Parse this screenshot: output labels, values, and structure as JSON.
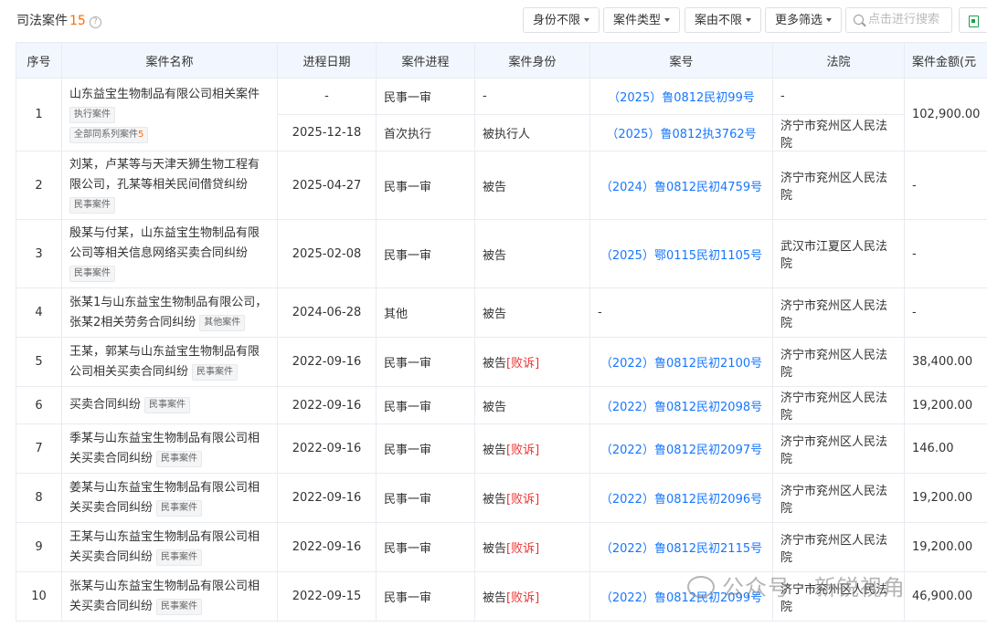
{
  "header": {
    "title": "司法案件",
    "count": "15",
    "help_icon": "?",
    "filters": [
      "身份不限",
      "案件类型",
      "案由不限",
      "更多筛选"
    ],
    "search_placeholder": "点击进行搜索"
  },
  "table": {
    "columns": [
      "序号",
      "案件名称",
      "进程日期",
      "案件进程",
      "案件身份",
      "案号",
      "法院",
      "案件金额(元"
    ],
    "rows": [
      {
        "no": "1",
        "name": "山东益宝生物制品有限公司相关案件",
        "tag": "执行案件",
        "tag2": "全部同系列案件",
        "tag2_count": "5",
        "sub": [
          {
            "date": "-",
            "stage": "民事一审",
            "role": "-",
            "case_no": "（2025）鲁0812民初99号",
            "court": "-"
          },
          {
            "date": "2025-12-18",
            "stage": "首次执行",
            "role": "被执行人",
            "case_no": "（2025）鲁0812执3762号",
            "court": "济宁市兖州区人民法院"
          }
        ],
        "amount": "102,900.00"
      },
      {
        "no": "2",
        "name": "刘某，卢某等与天津天狮生物工程有限公司，孔某等相关民间借贷纠纷",
        "tag": "民事案件",
        "date": "2025-04-27",
        "stage": "民事一审",
        "role": "被告",
        "lose": "",
        "case_no": "（2024）鲁0812民初4759号",
        "court": "济宁市兖州区人民法院",
        "amount": "-"
      },
      {
        "no": "3",
        "name": "殷某与付某，山东益宝生物制品有限公司等相关信息网络买卖合同纠纷",
        "tag": "民事案件",
        "date": "2025-02-08",
        "stage": "民事一审",
        "role": "被告",
        "lose": "",
        "case_no": "（2025）鄂0115民初1105号",
        "court": "武汉市江夏区人民法院",
        "amount": "-"
      },
      {
        "no": "4",
        "name": "张某1与山东益宝生物制品有限公司，张某2相关劳务合同纠纷",
        "tag": "其他案件",
        "date": "2024-06-28",
        "stage": "其他",
        "role": "被告",
        "lose": "",
        "case_no": "-",
        "court": "济宁市兖州区人民法院",
        "amount": "-"
      },
      {
        "no": "5",
        "name": "王某，郭某与山东益宝生物制品有限公司相关买卖合同纠纷",
        "tag": "民事案件",
        "date": "2022-09-16",
        "stage": "民事一审",
        "role": "被告",
        "lose": "[败诉]",
        "case_no": "（2022）鲁0812民初2100号",
        "court": "济宁市兖州区人民法院",
        "amount": "38,400.00"
      },
      {
        "no": "6",
        "name": "买卖合同纠纷",
        "tag": "民事案件",
        "date": "2022-09-16",
        "stage": "民事一审",
        "role": "被告",
        "lose": "",
        "case_no": "（2022）鲁0812民初2098号",
        "court": "济宁市兖州区人民法院",
        "amount": "19,200.00"
      },
      {
        "no": "7",
        "name": "季某与山东益宝生物制品有限公司相关买卖合同纠纷",
        "tag": "民事案件",
        "date": "2022-09-16",
        "stage": "民事一审",
        "role": "被告",
        "lose": "[败诉]",
        "case_no": "（2022）鲁0812民初2097号",
        "court": "济宁市兖州区人民法院",
        "amount": "146.00"
      },
      {
        "no": "8",
        "name": "姜某与山东益宝生物制品有限公司相关买卖合同纠纷",
        "tag": "民事案件",
        "date": "2022-09-16",
        "stage": "民事一审",
        "role": "被告",
        "lose": "[败诉]",
        "case_no": "（2022）鲁0812民初2096号",
        "court": "济宁市兖州区人民法院",
        "amount": "19,200.00"
      },
      {
        "no": "9",
        "name": "王某与山东益宝生物制品有限公司相关买卖合同纠纷",
        "tag": "民事案件",
        "date": "2022-09-16",
        "stage": "民事一审",
        "role": "被告",
        "lose": "[败诉]",
        "case_no": "（2022）鲁0812民初2115号",
        "court": "济宁市兖州区人民法院",
        "amount": "19,200.00"
      },
      {
        "no": "10",
        "name": "张某与山东益宝生物制品有限公司相关买卖合同纠纷",
        "tag": "民事案件",
        "date": "2022-09-15",
        "stage": "民事一审",
        "role": "被告",
        "lose": "[败诉]",
        "case_no": "（2022）鲁0812民初2099号",
        "court": "济宁市兖州区人民法院",
        "amount": "46,900.00"
      }
    ]
  },
  "watermark": "公众号 · 新锐视角",
  "colors": {
    "accent": "#1677ff",
    "count": "#ff6a00",
    "lose": "#ee3333",
    "header_bg": "#f2f7ff"
  }
}
